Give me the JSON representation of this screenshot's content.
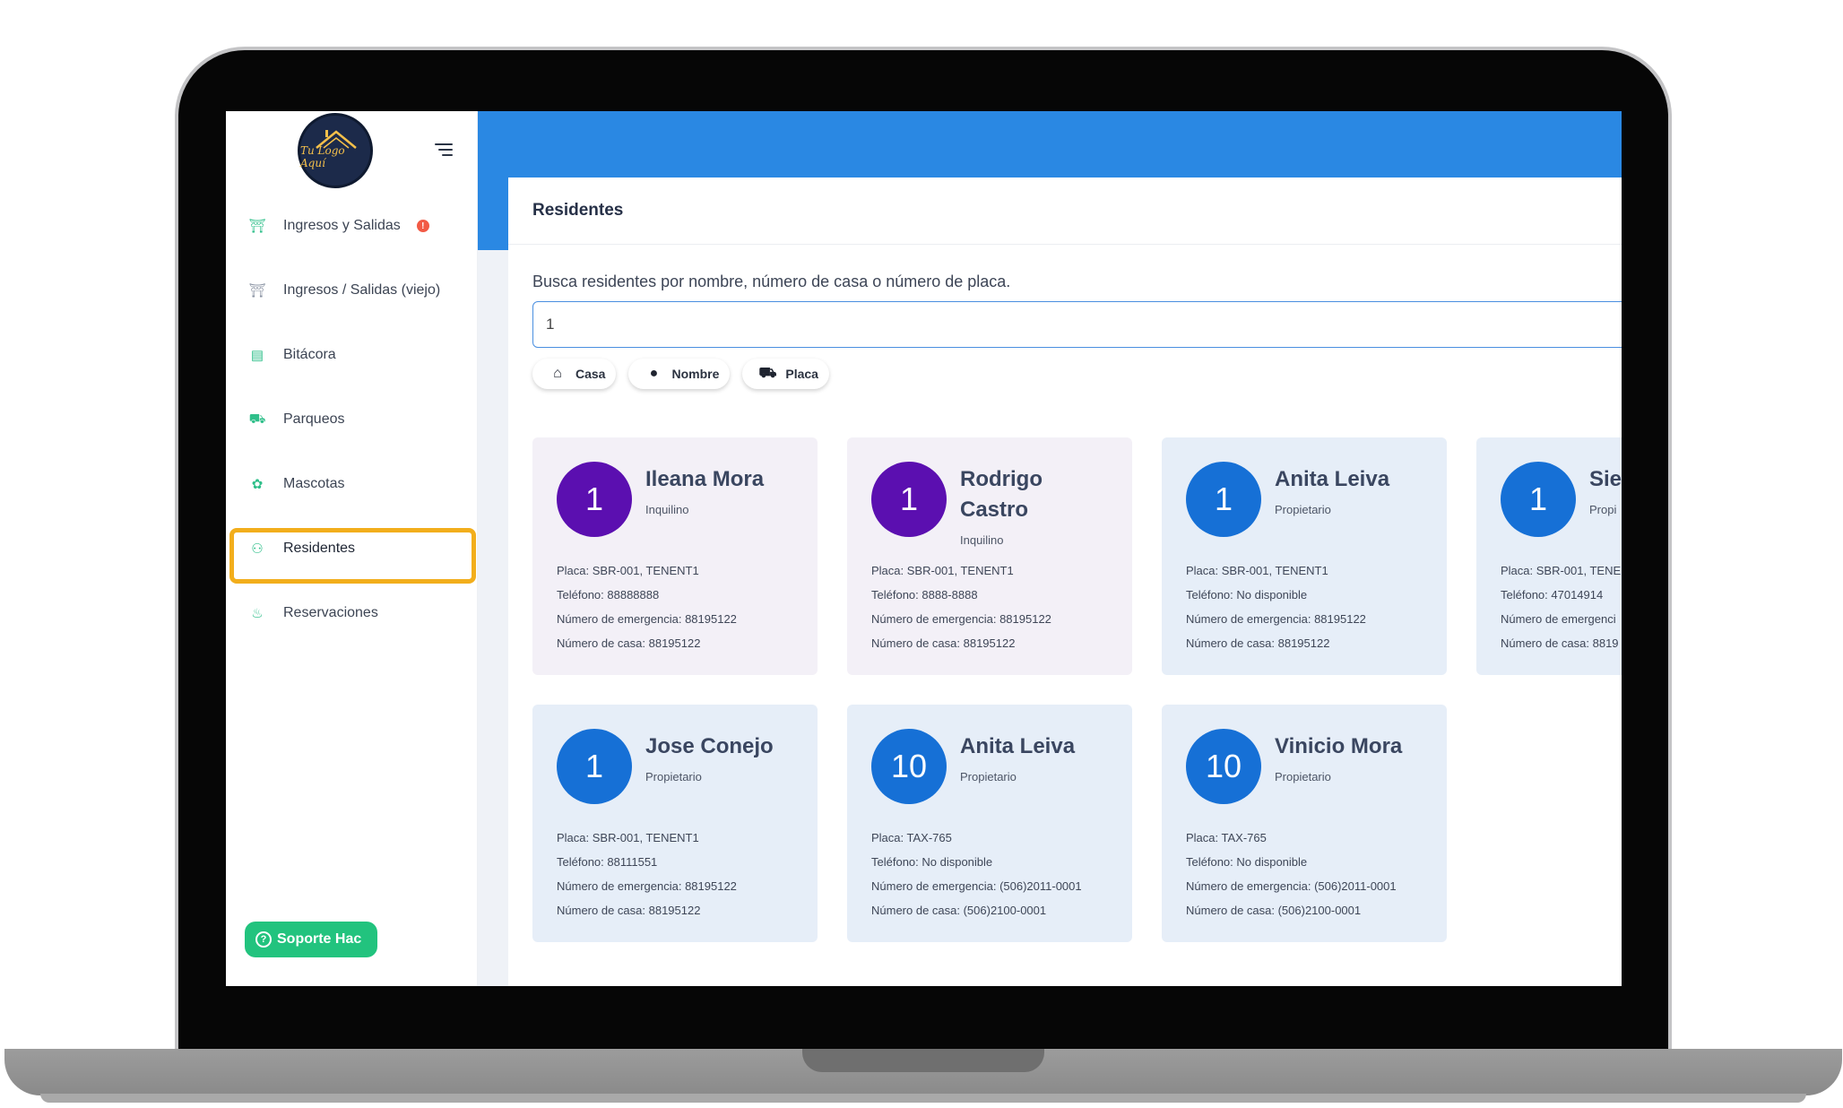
{
  "sidebar": {
    "logo_text": "Tu Logo Aquí",
    "items": [
      {
        "label": "Ingresos y Salidas",
        "icon": "gate-icon",
        "badge": "!"
      },
      {
        "label": "Ingresos / Salidas (viejo)",
        "icon": "gate-old-icon"
      },
      {
        "label": "Bitácora",
        "icon": "clipboard-icon"
      },
      {
        "label": "Parqueos",
        "icon": "car-icon"
      },
      {
        "label": "Mascotas",
        "icon": "paw-icon"
      },
      {
        "label": "Residentes",
        "icon": "people-icon"
      },
      {
        "label": "Reservaciones",
        "icon": "pool-icon"
      }
    ],
    "active": "Residentes",
    "support_label": "Soporte Hac",
    "accent_color": "#22c37e",
    "highlight_color": "#f2ae1c"
  },
  "header": {
    "bar_color": "#2a88e3"
  },
  "main": {
    "title": "Residentes",
    "search": {
      "label": "Busca residentes por nombre, número de casa o número de placa.",
      "value": "1",
      "placeholder": ""
    },
    "filters": [
      {
        "label": "Casa",
        "icon": "home-icon"
      },
      {
        "label": "Nombre",
        "icon": "person-icon"
      },
      {
        "label": "Placa",
        "icon": "car-icon"
      }
    ],
    "residents": [
      {
        "number": "1",
        "name": "Ileana Mora",
        "role": "Inquilino",
        "placa": "Placa: SBR-001, TENENT1",
        "telefono": "Teléfono: 88888888",
        "emergencia": "Número de emergencia: 88195122",
        "casa": "Número de casa: 88195122",
        "color": "#5b0fb0"
      },
      {
        "number": "1",
        "name": "Rodrigo Castro",
        "role": "Inquilino",
        "placa": "Placa: SBR-001, TENENT1",
        "telefono": "Teléfono: 8888-8888",
        "emergencia": "Número de emergencia: 88195122",
        "casa": "Número de casa: 88195122",
        "color": "#5b0fb0"
      },
      {
        "number": "1",
        "name": "Anita Leiva",
        "role": "Propietario",
        "placa": "Placa: SBR-001, TENENT1",
        "telefono": "Teléfono: No disponible",
        "emergencia": "Número de emergencia: 88195122",
        "casa": "Número de casa: 88195122",
        "color": "#1670d6"
      },
      {
        "number": "1",
        "name": "Sie",
        "role": "Propi",
        "placa": "Placa: SBR-001, TENEN",
        "telefono": "Teléfono: 47014914",
        "emergencia": "Número de emergenci",
        "casa": "Número de casa: 8819",
        "color": "#1670d6"
      },
      {
        "number": "1",
        "name": "Jose Conejo",
        "role": "Propietario",
        "placa": "Placa: SBR-001, TENENT1",
        "telefono": "Teléfono: 88111551",
        "emergencia": "Número de emergencia: 88195122",
        "casa": "Número de casa: 88195122",
        "color": "#1670d6"
      },
      {
        "number": "10",
        "name": "Anita Leiva",
        "role": "Propietario",
        "placa": "Placa: TAX-765",
        "telefono": "Teléfono: No disponible",
        "emergencia": "Número de emergencia: (506)2011-0001",
        "casa": "Número de casa: (506)2100-0001",
        "color": "#1670d6"
      },
      {
        "number": "10",
        "name": "Vinicio Mora",
        "role": "Propietario",
        "placa": "Placa: TAX-765",
        "telefono": "Teléfono: No disponible",
        "emergencia": "Número de emergencia: (506)2011-0001",
        "casa": "Número de casa: (506)2100-0001",
        "color": "#1670d6"
      }
    ]
  }
}
